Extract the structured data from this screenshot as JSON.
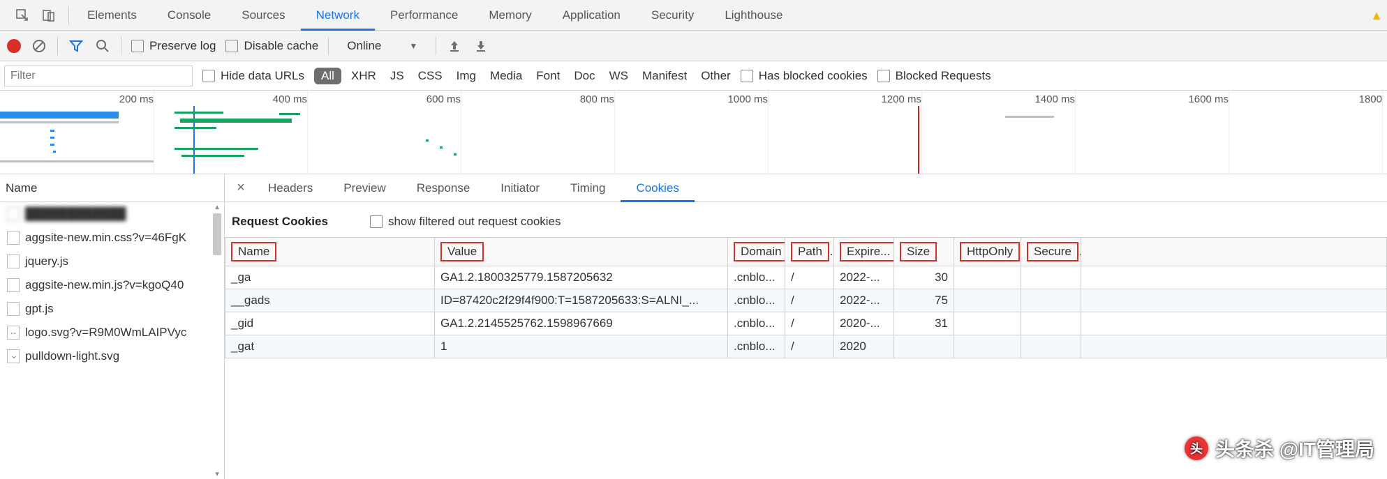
{
  "topTabs": [
    "Elements",
    "Console",
    "Sources",
    "Network",
    "Performance",
    "Memory",
    "Application",
    "Security",
    "Lighthouse"
  ],
  "activeTopTab": "Network",
  "toolbar": {
    "preserve_log": "Preserve log",
    "disable_cache": "Disable cache",
    "throttle": "Online"
  },
  "filterbar": {
    "placeholder": "Filter",
    "hide_data_urls": "Hide data URLs",
    "all": "All",
    "types": [
      "XHR",
      "JS",
      "CSS",
      "Img",
      "Media",
      "Font",
      "Doc",
      "WS",
      "Manifest",
      "Other"
    ],
    "has_blocked": "Has blocked cookies",
    "blocked_req": "Blocked Requests"
  },
  "timeline_ticks": [
    "200 ms",
    "400 ms",
    "600 ms",
    "800 ms",
    "1000 ms",
    "1200 ms",
    "1400 ms",
    "1600 ms",
    "1800"
  ],
  "leftHeader": "Name",
  "requests": [
    {
      "name": "",
      "blur": true,
      "icon": "doc"
    },
    {
      "name": "aggsite-new.min.css?v=46FgK",
      "icon": "doc"
    },
    {
      "name": "jquery.js",
      "icon": "doc"
    },
    {
      "name": "aggsite-new.min.js?v=kgoQ40",
      "icon": "doc"
    },
    {
      "name": "gpt.js",
      "icon": "doc"
    },
    {
      "name": "logo.svg?v=R9M0WmLAIPVyc",
      "icon": "svg"
    },
    {
      "name": "pulldown-light.svg",
      "icon": "dl"
    }
  ],
  "detailTabs": [
    "Headers",
    "Preview",
    "Response",
    "Initiator",
    "Timing",
    "Cookies"
  ],
  "activeDetailTab": "Cookies",
  "section_title": "Request Cookies",
  "show_filtered": "show filtered out request cookies",
  "cookie_cols": [
    "Name",
    "Value",
    "Domain",
    "Path",
    "Expire...",
    "Size",
    "HttpOnly",
    "Secure"
  ],
  "cookies": [
    {
      "name": "_ga",
      "value": "GA1.2.1800325779.1587205632",
      "domain": ".cnblo...",
      "path": "/",
      "expires": "2022-...",
      "size": "30",
      "http": "",
      "secure": ""
    },
    {
      "name": "__gads",
      "value": "ID=87420c2f29f4f900:T=1587205633:S=ALNI_...",
      "domain": ".cnblo...",
      "path": "/",
      "expires": "2022-...",
      "size": "75",
      "http": "",
      "secure": ""
    },
    {
      "name": "_gid",
      "value": "GA1.2.2145525762.1598967669",
      "domain": ".cnblo...",
      "path": "/",
      "expires": "2020-...",
      "size": "31",
      "http": "",
      "secure": ""
    },
    {
      "name": "_gat",
      "value": "1",
      "domain": ".cnblo...",
      "path": "/",
      "expires": "2020",
      "size": "",
      "http": "",
      "secure": ""
    }
  ],
  "watermark": "头条杀 @IT管理局"
}
